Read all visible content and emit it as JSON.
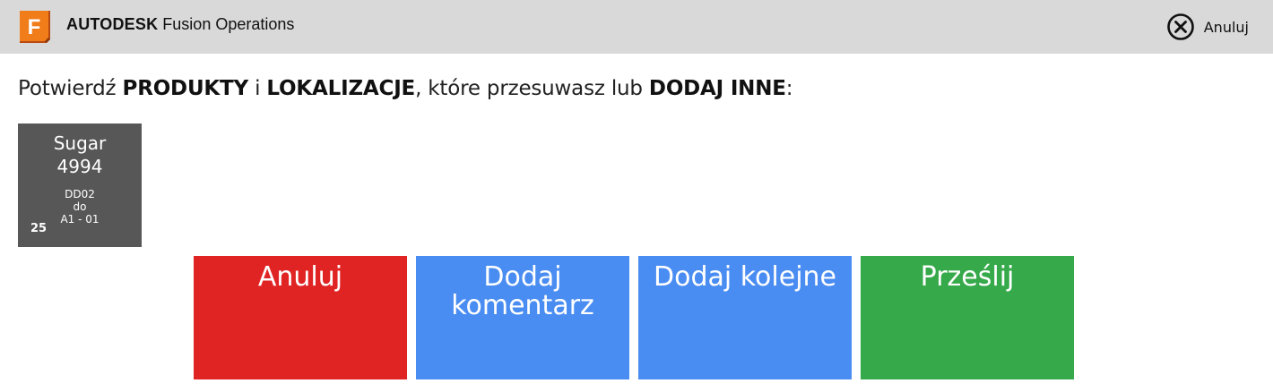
{
  "header": {
    "logo_letter": "F",
    "brand_bold": "AUTODESK",
    "brand_rest": "Fusion Operations",
    "cancel_label": "Anuluj",
    "cancel_icon": "close-circle-icon"
  },
  "prompt": {
    "part1": "Potwierdź ",
    "bold1": "PRODUKTY",
    "part2": " i ",
    "bold2": "LOKALIZACJE",
    "part3": ", które przesuwasz lub ",
    "bold3": "DODAJ INNE",
    "part4": ":"
  },
  "items": [
    {
      "name": "Sugar",
      "id": "4994",
      "from": "DD02",
      "connector": "do",
      "to": "A1 - 01",
      "quantity": "25"
    }
  ],
  "actions": {
    "cancel": "Anuluj",
    "add_comment": "Dodaj komentarz",
    "add_another": "Dodaj kolejne",
    "submit": "Prześlij"
  },
  "colors": {
    "header_bg": "#d9d9d9",
    "tile_bg": "#575757",
    "cancel_red": "#e02424",
    "action_blue": "#4a8df2",
    "submit_green": "#36a94a",
    "logo_orange": "#f07d1a"
  }
}
